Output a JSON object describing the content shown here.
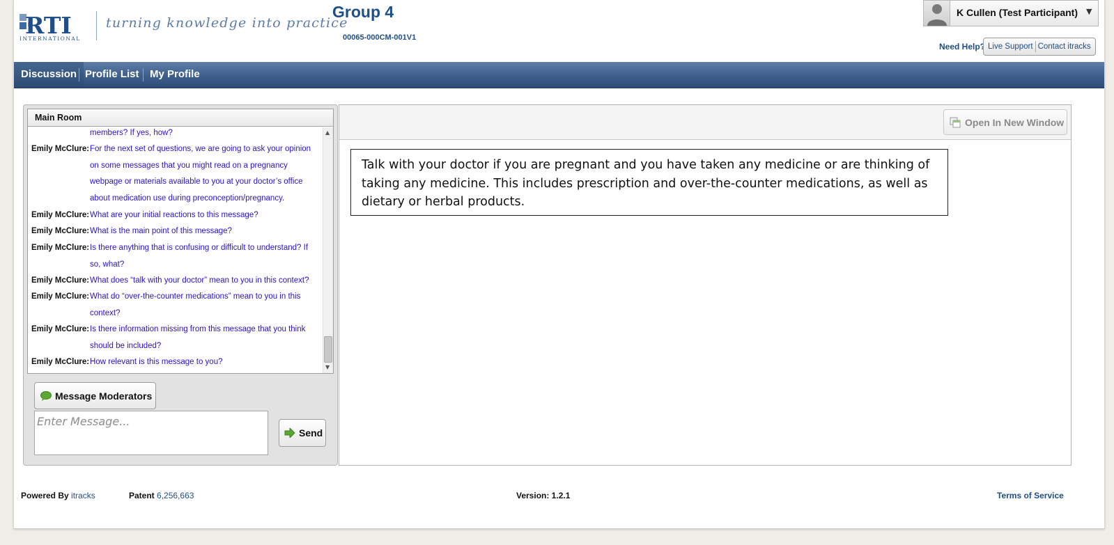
{
  "header": {
    "logo_text": "RTI",
    "logo_sub": "INTERNATIONAL",
    "tagline": "turning knowledge into practice",
    "group_title": "Group 4",
    "group_code": "00065-000CM-001V1",
    "user_name": "K Cullen (Test Participant)",
    "need_help": "Need Help?",
    "live_support": "Live Support",
    "contact": "Contact itracks"
  },
  "nav": {
    "items": [
      {
        "label": "Discussion",
        "active": true
      },
      {
        "label": "Profile List",
        "active": false
      },
      {
        "label": "My Profile",
        "active": false
      }
    ]
  },
  "chat": {
    "room_title": "Main Room",
    "messages": [
      {
        "author": "",
        "text": "members? If yes, how?"
      },
      {
        "author": "Emily McClure:",
        "text": "For the next set of questions, we are going to ask your opinion on some messages that you might read on a pregnancy webpage or materials available to you at your doctor’s office about medication use during preconception/pregnancy."
      },
      {
        "author": "Emily McClure:",
        "text": "What are your initial reactions to this message?"
      },
      {
        "author": "Emily McClure:",
        "text": "What is the main point of this message?"
      },
      {
        "author": "Emily McClure:",
        "text": "Is there anything that is confusing or difficult to understand? If so, what?"
      },
      {
        "author": "Emily McClure:",
        "text": "What does “talk with your doctor” mean to you in this context?"
      },
      {
        "author": "Emily McClure:",
        "text": "What do “over-the-counter medications” mean to you in this context?"
      },
      {
        "author": "Emily McClure:",
        "text": "Is there information missing from this message that you think should be included?"
      },
      {
        "author": "Emily McClure:",
        "text": "How relevant is this message to you?"
      }
    ],
    "message_moderators_label": "Message Moderators",
    "input_placeholder": "Enter Message...",
    "send_label": "Send"
  },
  "content": {
    "open_window_label": "Open In New Window",
    "message_text": "Talk with your doctor if you are pregnant and you have taken any medicine or are thinking of taking any medicine. This includes prescription and over-the-counter medications, as well as dietary or herbal products."
  },
  "footer": {
    "powered_by_label": "Powered By",
    "powered_by_link": "itracks",
    "patent_label": "Patent",
    "patent_number": "6,256,663",
    "version": "Version: 1.2.1",
    "terms": "Terms of Service"
  },
  "colors": {
    "brand_blue": "#1f4e8a",
    "message_text": "#2a13c9",
    "nav_bg": "#3e5f8c"
  }
}
